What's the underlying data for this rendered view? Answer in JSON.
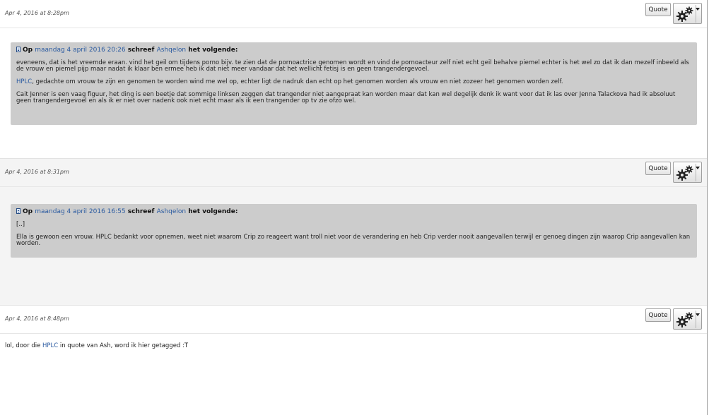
{
  "posts": [
    {
      "date": "Apr 4, 2016 at 8:28pm",
      "quote_label": "Quote",
      "quote": {
        "prefix": "Op",
        "date_link": "maandag 4 april 2016 20:26",
        "wrote": "schreef",
        "author_link": "Ashqelon",
        "suffix": "het volgende:",
        "paragraphs": [
          "eveneens, dat is het vreemde eraan. vind het geil om tijdens porno bijv. te zien dat de pornoactrice genomen wordt en vind de pornoacteur zelf niet echt geil behalve piemel echter is het wel zo dat ik dan mezelf inbeeld als de vrouw en piemel pijp maar nadat ik klaar ben ermee heb ik dat niet meer vandaar dat het wellicht fetisj is en geen trangendergevoel.",
          "Cait Jenner is een vaag figuur, het ding is een beetje dat sommige linksen zeggen dat trangender niet aangepraat kan worden maar dat kan wel degelijk denk ik want voor dat ik las over Jenna Talackova had ik absoluut geen trangendergevoel en als ik er niet over nadenk ook niet echt maar als ik een trangender op tv zie ofzo wel."
        ],
        "hplc_link": "HPLC",
        "hplc_text": ", gedachte om vrouw te zijn en genomen te worden wind me wel op, echter ligt de nadruk dan echt op het genomen worden als vrouw en niet zozeer het genomen worden zelf."
      }
    },
    {
      "date": "Apr 4, 2016 at 8:31pm",
      "quote_label": "Quote",
      "quote": {
        "prefix": "Op",
        "date_link": "maandag 4 april 2016 16:55",
        "wrote": "schreef",
        "author_link": "Ashqelon",
        "suffix": "het volgende:",
        "ellipsis": "[..]",
        "text": "Ella is gewoon een vrouw. HPLC bedankt voor opnemen, weet niet waarom Crip zo reageert want troll niet voor de verandering en heb Crip verder nooit aangevallen terwijl er genoeg dingen zijn waarop Crip aangevallen kan worden."
      }
    },
    {
      "date": "Apr 4, 2016 at 8:48pm",
      "quote_label": "Quote",
      "body_pre": "lol, door die ",
      "body_link": "HPLC",
      "body_post": " in quote van Ash, word ik hier getagged :T"
    }
  ],
  "icons": {
    "options": "gears-icon",
    "dropdown": "caret-down-icon",
    "quote_marker": "document-icon"
  },
  "colors": {
    "link": "#2a5aa0",
    "quote_background": "#cccccc",
    "alt_row": "#f4f4f4"
  }
}
